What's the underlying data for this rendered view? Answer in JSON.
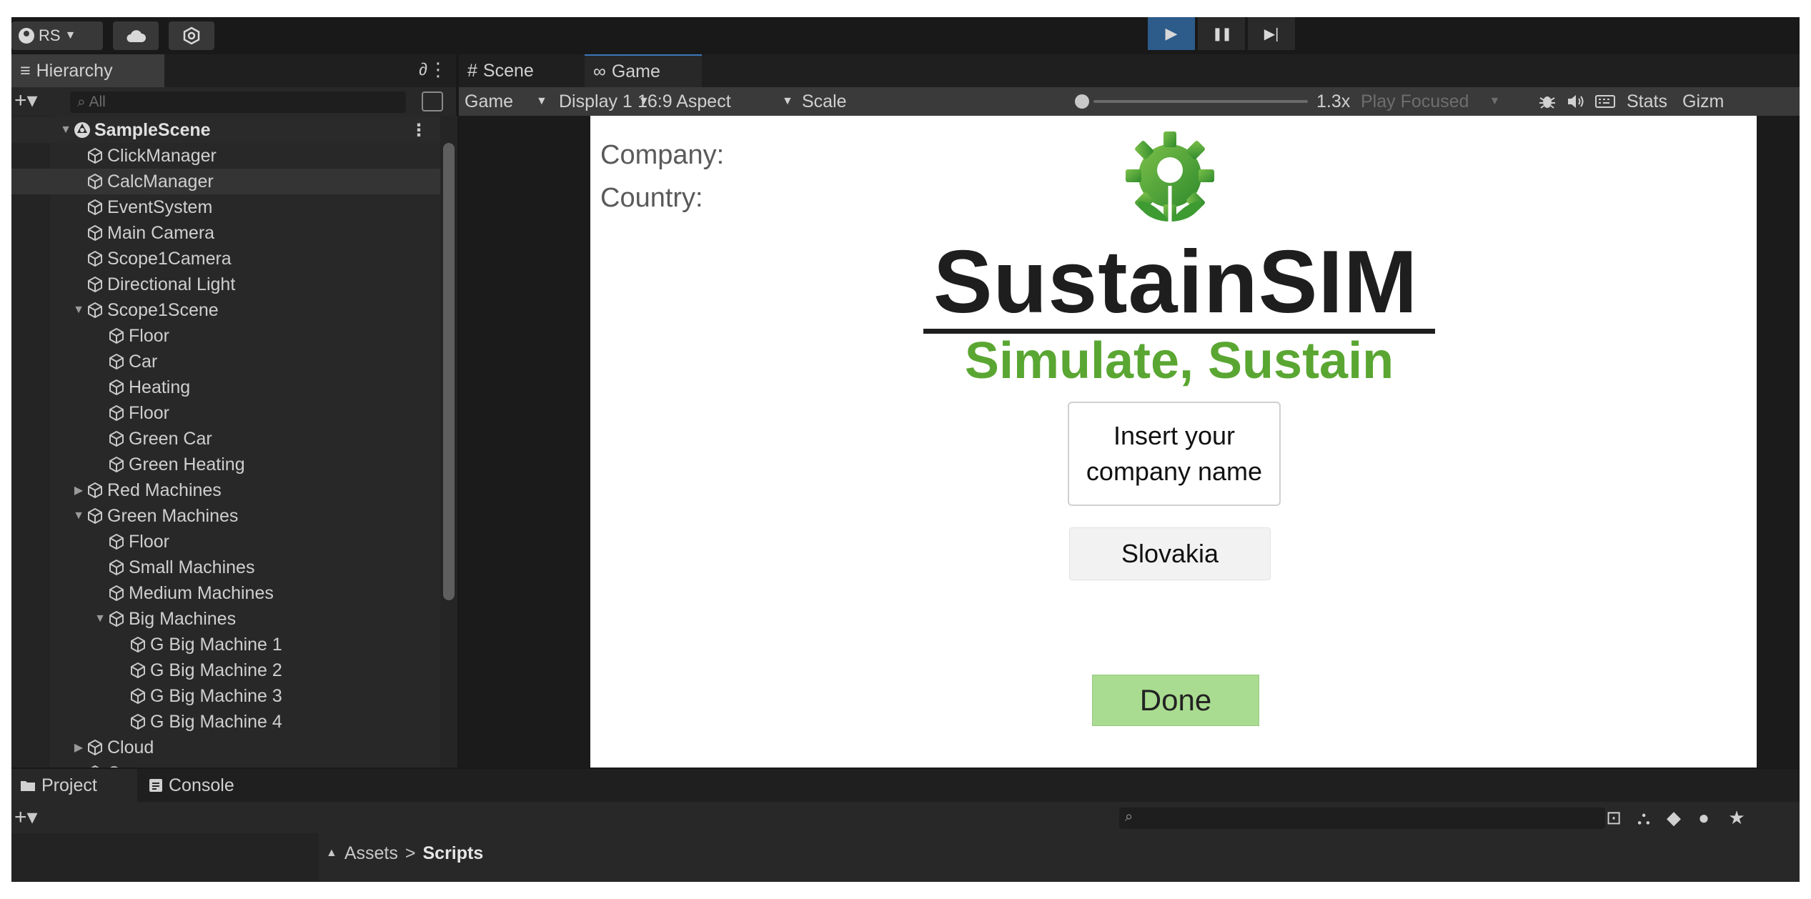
{
  "toolbar": {
    "account_label": "RS",
    "account_caret": "▼",
    "cloud_icon": "cloud-icon",
    "collab_icon": "collab-icon",
    "play_icon": "▶",
    "pause_icon": "❚❚",
    "step_icon": "▶|"
  },
  "hierarchy": {
    "tab_label": "Hierarchy",
    "tab_glyph": "≡",
    "lock_glyph": "∂",
    "menu_glyph": "⋮",
    "add_label": "+▾",
    "search_placeholder": "All",
    "search_glyph": "⌕",
    "items": [
      {
        "label": "SampleScene",
        "depth": 0,
        "fold": "▼",
        "kind": "scene"
      },
      {
        "label": "ClickManager",
        "depth": 1,
        "fold": ""
      },
      {
        "label": "CalcManager",
        "depth": 1,
        "fold": "",
        "selected": true
      },
      {
        "label": "EventSystem",
        "depth": 1,
        "fold": ""
      },
      {
        "label": "Main Camera",
        "depth": 1,
        "fold": ""
      },
      {
        "label": "Scope1Camera",
        "depth": 1,
        "fold": ""
      },
      {
        "label": "Directional Light",
        "depth": 1,
        "fold": ""
      },
      {
        "label": "Scope1Scene",
        "depth": 1,
        "fold": "▼"
      },
      {
        "label": "Floor",
        "depth": 2,
        "fold": ""
      },
      {
        "label": "Car",
        "depth": 2,
        "fold": ""
      },
      {
        "label": "Heating",
        "depth": 2,
        "fold": ""
      },
      {
        "label": "Floor",
        "depth": 2,
        "fold": ""
      },
      {
        "label": "Green Car",
        "depth": 2,
        "fold": ""
      },
      {
        "label": "Green Heating",
        "depth": 2,
        "fold": ""
      },
      {
        "label": "Red Machines",
        "depth": 1,
        "fold": "▶"
      },
      {
        "label": "Green Machines",
        "depth": 1,
        "fold": "▼"
      },
      {
        "label": "Floor",
        "depth": 2,
        "fold": ""
      },
      {
        "label": "Small Machines",
        "depth": 2,
        "fold": ""
      },
      {
        "label": "Medium Machines",
        "depth": 2,
        "fold": ""
      },
      {
        "label": "Big Machines",
        "depth": 2,
        "fold": "▼"
      },
      {
        "label": "G Big Machine 1",
        "depth": 3,
        "fold": ""
      },
      {
        "label": "G Big Machine 2",
        "depth": 3,
        "fold": ""
      },
      {
        "label": "G Big Machine 3",
        "depth": 3,
        "fold": ""
      },
      {
        "label": "G Big Machine 4",
        "depth": 3,
        "fold": ""
      },
      {
        "label": "Cloud",
        "depth": 1,
        "fold": "▶"
      },
      {
        "label": "Canvas",
        "depth": 1,
        "fold": "▶"
      }
    ]
  },
  "game_view": {
    "scene_tab": "Scene",
    "scene_tab_glyph": "#",
    "game_tab": "Game",
    "game_tab_glyph": "∞",
    "mode_select": "Game",
    "display_select": "Display 1",
    "aspect_select": "16:9 Aspect",
    "scale_label": "Scale",
    "scale_value": "1.3x",
    "scale_fraction": 0.0,
    "play_focused_select": "Play Focused",
    "stats_label": "Stats",
    "gizmos_label": "Gizm"
  },
  "game": {
    "company_label": "Company:",
    "country_label": "Country:",
    "brand_title": "SustainSIM",
    "brand_tagline": "Simulate, Sustain",
    "company_input_placeholder": "Insert your company name",
    "country_value": "Slovakia",
    "done_label": "Done",
    "brand_green": "#5aa632",
    "brand_dark": "#1e1e1e"
  },
  "bottom": {
    "project_tab": "Project",
    "console_tab": "Console",
    "add_label": "+▾",
    "breadcrumb": [
      "Assets",
      "Scripts"
    ],
    "breadcrumb_sep": ">",
    "breadcrumb_caret": "▲"
  },
  "colors": {
    "editor_bg": "#191919",
    "panel_bg": "#282828",
    "play_active": "#2d5b8a",
    "done_green": "#a9dc90"
  }
}
